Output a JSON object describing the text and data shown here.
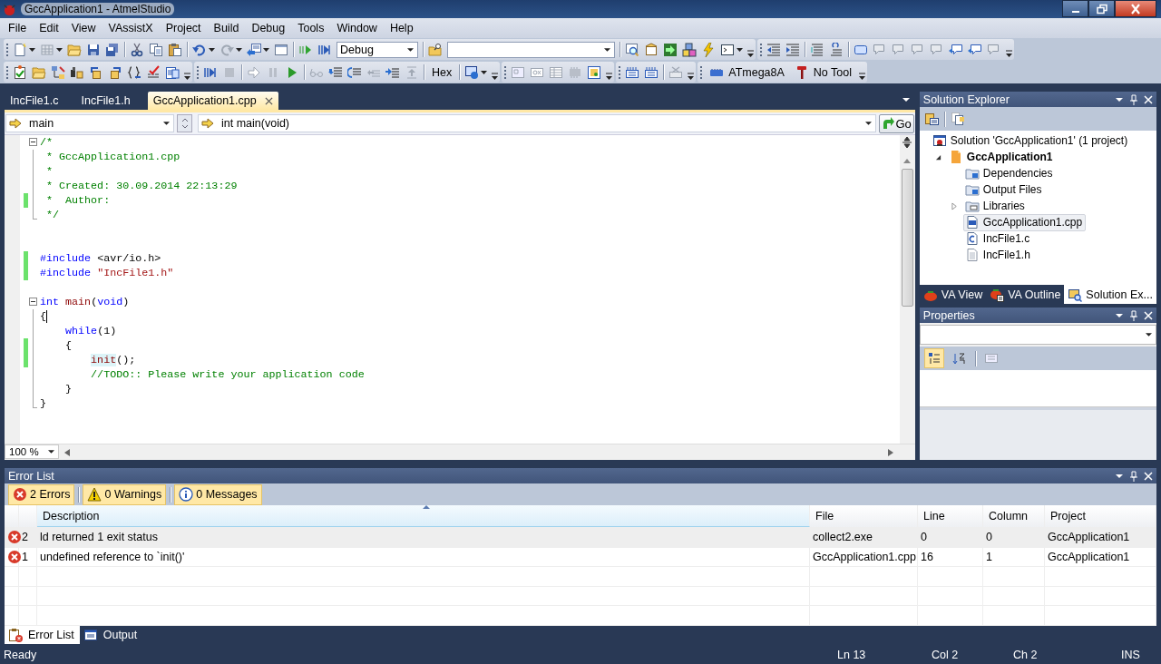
{
  "window": {
    "title": "GccApplication1 - AtmelStudio"
  },
  "menu": [
    "File",
    "Edit",
    "View",
    "VAssistX",
    "Project",
    "Build",
    "Debug",
    "Tools",
    "Window",
    "Help"
  ],
  "toolbar": {
    "configuration": "Debug",
    "hex_button": "Hex",
    "device": "ATmega8A",
    "tool": "No Tool"
  },
  "editor_tabs": [
    {
      "label": "IncFile1.c",
      "selected": false
    },
    {
      "label": "IncFile1.h",
      "selected": false
    },
    {
      "label": "GccApplication1.cpp",
      "selected": true
    }
  ],
  "navigation": {
    "scope": "main",
    "member": "int main(void)",
    "go_button": "Go"
  },
  "code_blocks": [
    {
      "lines": [
        {
          "tokens": [
            {
              "kind": "comment",
              "text": "/*"
            }
          ],
          "changed": false,
          "caret": false,
          "expanded": true,
          "children": [
            {
              "tokens": [
                {
                  "kind": "comment",
                  "text": " * GccApplication1.cpp"
                }
              ],
              "changed": false,
              "caret": false
            },
            {
              "tokens": [
                {
                  "kind": "comment",
                  "text": " *"
                }
              ],
              "changed": false,
              "caret": false
            },
            {
              "tokens": [
                {
                  "kind": "comment",
                  "text": " * Created: 30.09.2014 22:13:29"
                }
              ],
              "changed": false,
              "caret": false
            },
            {
              "tokens": [
                {
                  "kind": "comment",
                  "text": " *  Author:"
                }
              ],
              "changed": true,
              "caret": false
            },
            {
              "tokens": [
                {
                  "kind": "comment",
                  "text": " */"
                }
              ],
              "changed": false,
              "caret": false
            }
          ]
        }
      ]
    },
    {
      "lines": [
        {
          "tokens": [
            {
              "kind": "keyword",
              "text": "#include"
            },
            {
              "kind": "plain",
              "text": " <avr/io.h>"
            }
          ],
          "changed": true,
          "caret": false
        },
        {
          "tokens": [
            {
              "kind": "keyword",
              "text": "#include"
            },
            {
              "kind": "string",
              "text": " \"IncFile1.h\""
            }
          ],
          "changed": true,
          "caret": false
        }
      ]
    },
    {
      "lines": [
        {
          "tokens": [
            {
              "kind": "keyword",
              "text": "int"
            },
            {
              "kind": "function",
              "text": " main"
            },
            {
              "kind": "plain",
              "text": "("
            },
            {
              "kind": "keyword",
              "text": "void"
            },
            {
              "kind": "plain",
              "text": ")"
            }
          ],
          "changed": false,
          "caret": false,
          "expanded": true,
          "children": [
            {
              "tokens": [
                {
                  "kind": "plain",
                  "text": "{"
                }
              ],
              "changed": false,
              "caret": true
            },
            {
              "tokens": [
                {
                  "kind": "keyword",
                  "text": "    while"
                },
                {
                  "kind": "plain",
                  "text": "(1)"
                }
              ],
              "changed": false,
              "caret": false
            },
            {
              "tokens": [
                {
                  "kind": "plain",
                  "text": "    {"
                }
              ],
              "changed": true,
              "caret": false
            },
            {
              "tokens": [
                {
                  "kind": "match",
                  "text": "        init"
                },
                {
                  "kind": "plain",
                  "text": "();"
                }
              ],
              "changed": true,
              "caret": false
            },
            {
              "tokens": [
                {
                  "kind": "comment",
                  "text": "        //TODO:: Please write your application code"
                }
              ],
              "changed": false,
              "caret": false
            },
            {
              "tokens": [
                {
                  "kind": "plain",
                  "text": "    }"
                }
              ],
              "changed": false,
              "caret": false
            },
            {
              "tokens": [
                {
                  "kind": "plain",
                  "text": "}"
                }
              ],
              "changed": false,
              "caret": false
            }
          ]
        }
      ]
    }
  ],
  "zoom": "100 %",
  "solution_explorer": {
    "title": "Solution Explorer",
    "tree": [
      {
        "label": "Solution 'GccApplication1' (1 project)",
        "kind": "solution",
        "startup": false,
        "selected": false,
        "children": [
          {
            "label": "GccApplication1",
            "kind": "project",
            "startup": true,
            "expanded": true,
            "selected": false,
            "children": [
              {
                "label": "Dependencies",
                "kind": "folder",
                "startup": false,
                "selected": false
              },
              {
                "label": "Output Files",
                "kind": "folder",
                "startup": false,
                "selected": false
              },
              {
                "label": "Libraries",
                "kind": "library",
                "startup": false,
                "expanded": false,
                "selected": false
              },
              {
                "label": "GccApplication1.cpp",
                "kind": "cpp",
                "startup": false,
                "selected": true
              },
              {
                "label": "IncFile1.c",
                "kind": "c",
                "startup": false,
                "selected": false
              },
              {
                "label": "IncFile1.h",
                "kind": "header",
                "startup": false,
                "selected": false
              }
            ]
          }
        ]
      }
    ]
  },
  "side_tabs": [
    {
      "label": "VA View",
      "selected": false
    },
    {
      "label": "VA Outline",
      "selected": false
    },
    {
      "label": "Solution Ex...",
      "selected": true
    }
  ],
  "properties": {
    "title": "Properties",
    "view_buttons": [
      {
        "selected": true
      },
      {
        "selected": false
      },
      {
        "selected": false
      }
    ]
  },
  "error_list": {
    "title": "Error List",
    "filters": [
      {
        "kind": "error",
        "label": "2 Errors",
        "on": true
      },
      {
        "kind": "warning",
        "label": "0 Warnings",
        "on": true
      },
      {
        "kind": "info",
        "label": "0 Messages",
        "on": true
      }
    ],
    "columns": [
      "Description",
      "File",
      "Line",
      "Column",
      "Project"
    ],
    "rows": [
      {
        "kind": "error",
        "number": "2",
        "description": "ld returned 1 exit status",
        "file": "collect2.exe",
        "line": "0",
        "column": "0",
        "project": "GccApplication1",
        "selected": true
      },
      {
        "kind": "error",
        "number": "1",
        "description": "undefined reference to `init()'",
        "file": "GccApplication1.cpp",
        "line": "16",
        "column": "1",
        "project": "GccApplication1",
        "selected": false
      }
    ]
  },
  "bottom_tabs": [
    {
      "label": "Error List",
      "selected": true
    },
    {
      "label": "Output",
      "selected": false
    }
  ],
  "status_bar": {
    "message": "Ready",
    "line": "Ln 13",
    "column": "Col 2",
    "char": "Ch 2",
    "mode": "INS"
  }
}
